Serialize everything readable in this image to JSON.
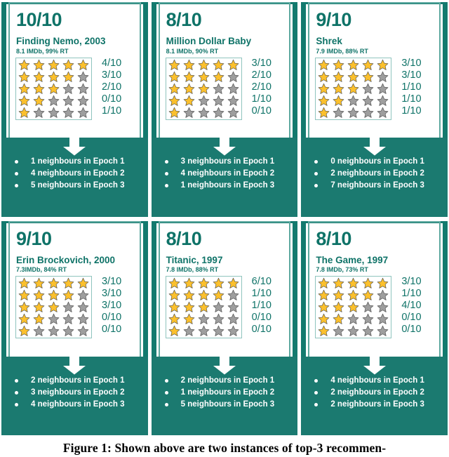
{
  "colors": {
    "teal_border": "#137a6e",
    "teal_panel": "#1b7a70",
    "teal_text": "#0f7368",
    "star_gold": "#fbc02d",
    "star_grey": "#9e9e9e",
    "star_outline": "#4a4a4a",
    "stars_box_border": "#8fc4be"
  },
  "caption": "Figure 1:  Shown above are two instances of top-3 recommen-",
  "cards": [
    {
      "score": "10/10",
      "title": "Finding Nemo, 2003",
      "meta": "8.1 IMDb, 99% RT",
      "star_rows": [
        5,
        4,
        3,
        2,
        1
      ],
      "fractions": [
        "4/10",
        "3/10",
        "2/10",
        "0/10",
        "1/10"
      ],
      "neighbours": [
        "1 neighbours in Epoch 1",
        "4 neighbours in Epoch 2",
        "5 neighbours in Epoch 3"
      ]
    },
    {
      "score": "8/10",
      "title": "Million Dollar Baby",
      "meta": "8.1 IMDb, 90% RT",
      "star_rows": [
        5,
        4,
        3,
        2,
        1
      ],
      "fractions": [
        "3/10",
        "2/10",
        "2/10",
        "1/10",
        "0/10"
      ],
      "neighbours": [
        "3 neighbours in Epoch 1",
        "4 neighbours in Epoch 2",
        "1 neighbours in Epoch 3"
      ]
    },
    {
      "score": "9/10",
      "title": "Shrek",
      "meta": "7.9 IMDb, 88% RT",
      "star_rows": [
        5,
        4,
        3,
        2,
        1
      ],
      "fractions": [
        "3/10",
        "3/10",
        "1/10",
        "1/10",
        "1/10"
      ],
      "neighbours": [
        "0 neighbours in Epoch 1",
        "2 neighbours in Epoch 2",
        "7 neighbours in Epoch 3"
      ]
    },
    {
      "score": "9/10",
      "title": "Erin Brockovich, 2000",
      "meta": "7.3IMDb, 84% RT",
      "star_rows": [
        5,
        4,
        3,
        2,
        1
      ],
      "fractions": [
        "3/10",
        "3/10",
        "3/10",
        "0/10",
        "0/10"
      ],
      "neighbours": [
        "2 neighbours in Epoch 1",
        "3 neighbours in Epoch 2",
        "4 neighbours in Epoch 3"
      ]
    },
    {
      "score": "8/10",
      "title": "Titanic, 1997",
      "meta": "7.8 IMDb, 88% RT",
      "star_rows": [
        5,
        4,
        3,
        2,
        1
      ],
      "fractions": [
        "6/10",
        "1/10",
        "1/10",
        "0/10",
        "0/10"
      ],
      "neighbours": [
        "2 neighbours in Epoch 1",
        "1 neighbours in Epoch 2",
        "5 neighbours in Epoch 3"
      ]
    },
    {
      "score": "8/10",
      "title": "The Game, 1997",
      "meta": "7.8 IMDb, 73% RT",
      "star_rows": [
        5,
        4,
        3,
        2,
        1
      ],
      "fractions": [
        "3/10",
        "1/10",
        "4/10",
        "0/10",
        "0/10"
      ],
      "neighbours": [
        "4 neighbours in Epoch 1",
        "2 neighbours in Epoch 2",
        "2 neighbours in Epoch 3"
      ]
    }
  ]
}
